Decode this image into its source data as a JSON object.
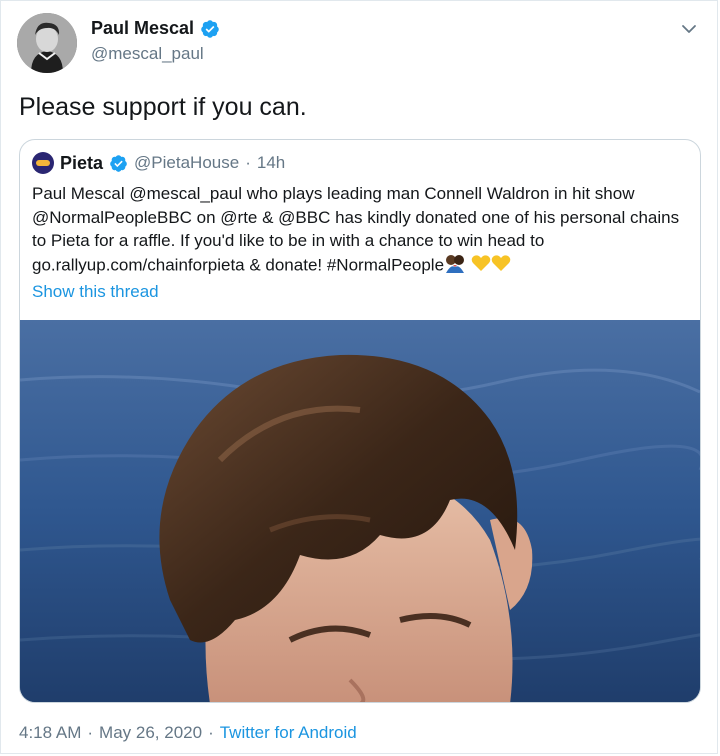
{
  "tweet": {
    "author_name": "Paul Mescal",
    "author_handle": "@mescal_paul",
    "text": "Please support if you can.",
    "time": "4:18 AM",
    "date": "May 26, 2020",
    "separator": "·",
    "source": "Twitter for Android"
  },
  "quote": {
    "author_name": "Pieta",
    "author_handle": "@PietaHouse",
    "separator": "·",
    "age": "14h",
    "text": "Paul Mescal @mescal_paul who plays leading man Connell Waldron in hit show @NormalPeopleBBC on @rte & @BBC has kindly donated one of his personal chains to Pieta for a raffle. If you'd like to be in with a chance to win head to go.rallyup.com/chainforpieta & donate! #NormalPeople",
    "emojis": [
      "couple-kiss-emoji",
      "yellow-heart-emoji",
      "yellow-heart-emoji"
    ],
    "show_thread": "Show this thread"
  },
  "colors": {
    "link": "#1b95e0",
    "secondary_text": "#657786",
    "verified": "#1da1f2",
    "border": "#ccd6dd"
  }
}
